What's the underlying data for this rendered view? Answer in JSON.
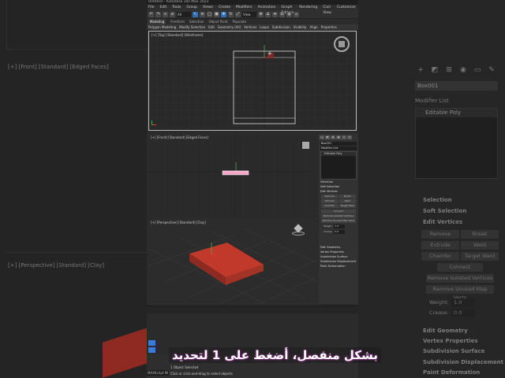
{
  "app": {
    "title": "Untitled - Autodesk 3ds Max 2023"
  },
  "menu": [
    "File",
    "Edit",
    "Tools",
    "Group",
    "Views",
    "Create",
    "Modifiers",
    "Animation",
    "Graph Editors",
    "Rendering",
    "Civil View",
    "Customize",
    "Scripting"
  ],
  "toolbar": {
    "selection_filter": "All",
    "ref_coord": "View"
  },
  "ribbon": {
    "tabs": [
      "Modeling",
      "Freeform",
      "Selection",
      "Object Paint",
      "Populate"
    ],
    "active_tab": "Modeling",
    "panels": [
      "Polygon Modeling",
      "Modify Selection",
      "Edit",
      "Geometry (All)",
      "Vertices",
      "Loops",
      "Subdivision",
      "Visibility",
      "Align",
      "Properties"
    ]
  },
  "viewports": {
    "top_label": "[+] [Top] [Standard] [Wireframe]",
    "front_label": "[+] [Front] [Standard] [Edged Faces]",
    "persp_label": "[+] [Perspective] [Standard] [Clay]"
  },
  "command_panel": {
    "object_name": "Box001",
    "modifier_list": "Modifier List",
    "stack_item": "Editable Poly",
    "sections": {
      "selection": "Selection",
      "soft_selection": "Soft Selection",
      "edit_vertices": "Edit Vertices",
      "edit_geometry": "Edit Geometry",
      "vertex_properties": "Vertex Properties",
      "subdivision_surface": "Subdivision Surface",
      "subdivision_displacement": "Subdivision Displacement",
      "paint_deformation": "Paint Deformation"
    },
    "buttons": {
      "remove": "Remove",
      "break": "Break",
      "extrude": "Extrude",
      "weld": "Weld",
      "chamfer": "Chamfer",
      "target_weld": "Target Weld",
      "connect": "Connect",
      "remove_isolated": "Remove Isolated Vertices",
      "remove_unused": "Remove Unused Map Verts"
    },
    "weight_label": "Weight:",
    "weight_value": "1.0",
    "crease_label": "Crease:",
    "crease_value": "0.0"
  },
  "status": {
    "line1": "1 Object Selected",
    "line2": "Click or click-and-drag to select objects",
    "maxscript": "MAXScript Mi"
  },
  "subtitle": "بشكل منفصل، أضغط على 1 لتحديد",
  "colors": {
    "accent": "#2f6fb8",
    "box_red": "#c0392b",
    "selection_pink": "#f4a7c6"
  }
}
